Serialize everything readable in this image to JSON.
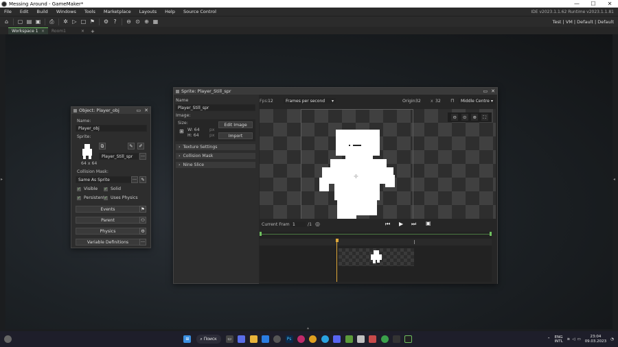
{
  "window": {
    "title": "Messing Around - GameMaker*",
    "minimize": "—",
    "maximize": "☐",
    "close": "✕"
  },
  "menu": {
    "items": [
      "File",
      "Edit",
      "Build",
      "Windows",
      "Tools",
      "Marketplace",
      "Layouts",
      "Help",
      "Source Control"
    ],
    "version": "IDE v2023.1.1.62  Runtime v2023.1.1.81"
  },
  "toolbar": {
    "target": "Test | VM | Default | Default"
  },
  "tabs": [
    {
      "label": "Workspace 1",
      "close": "×"
    },
    {
      "label": "Room1",
      "close": "×"
    }
  ],
  "add_tab": "+",
  "object_panel": {
    "title": "Object: Player_obj",
    "name_label": "Name:",
    "name_value": "Player_obj",
    "sprite_label": "Sprite:",
    "sprite_size": "64 x 64",
    "sprite_value": "Player_Still_spr",
    "sprite_more": "···",
    "collision_label": "Collision Mask:",
    "collision_value": "Same As Sprite",
    "collision_more": "···",
    "visible": "Visible",
    "solid": "Solid",
    "persistent": "Persistent",
    "uses_physics": "Uses Physics",
    "events": "Events",
    "parent": "Parent",
    "physics": "Physics",
    "variable_definitions": "Variable Definitions",
    "var_more": "···"
  },
  "sprite_panel": {
    "title": "Sprite: Player_Still_spr",
    "name_label": "Name",
    "name_value": "Player_Still_spr",
    "image_label": "Image:",
    "size_label": "Size:",
    "width": "W: 64",
    "height": "H: 64",
    "px": "px",
    "edit_image": "Edit Image",
    "import": "Import",
    "texture_settings": "Texture Settings",
    "collision_mask": "Collision Mask",
    "nine_slice": "Nine Slice",
    "fps_label": "Fps:",
    "fps_value": "12",
    "fps_mode": "Frames per second",
    "origin_label": "Origin:",
    "origin_x": "32",
    "origin_sep": "x",
    "origin_y": "32",
    "origin_mode": "Middle Centre",
    "current_frame_label": "Current Frame:",
    "current_frame_value": "1",
    "frame_total": "/1"
  },
  "taskbar": {
    "search": "Поиск",
    "lang": "ENG",
    "lang2": "INTL",
    "time": "23:04",
    "date": "09.03.2023"
  }
}
